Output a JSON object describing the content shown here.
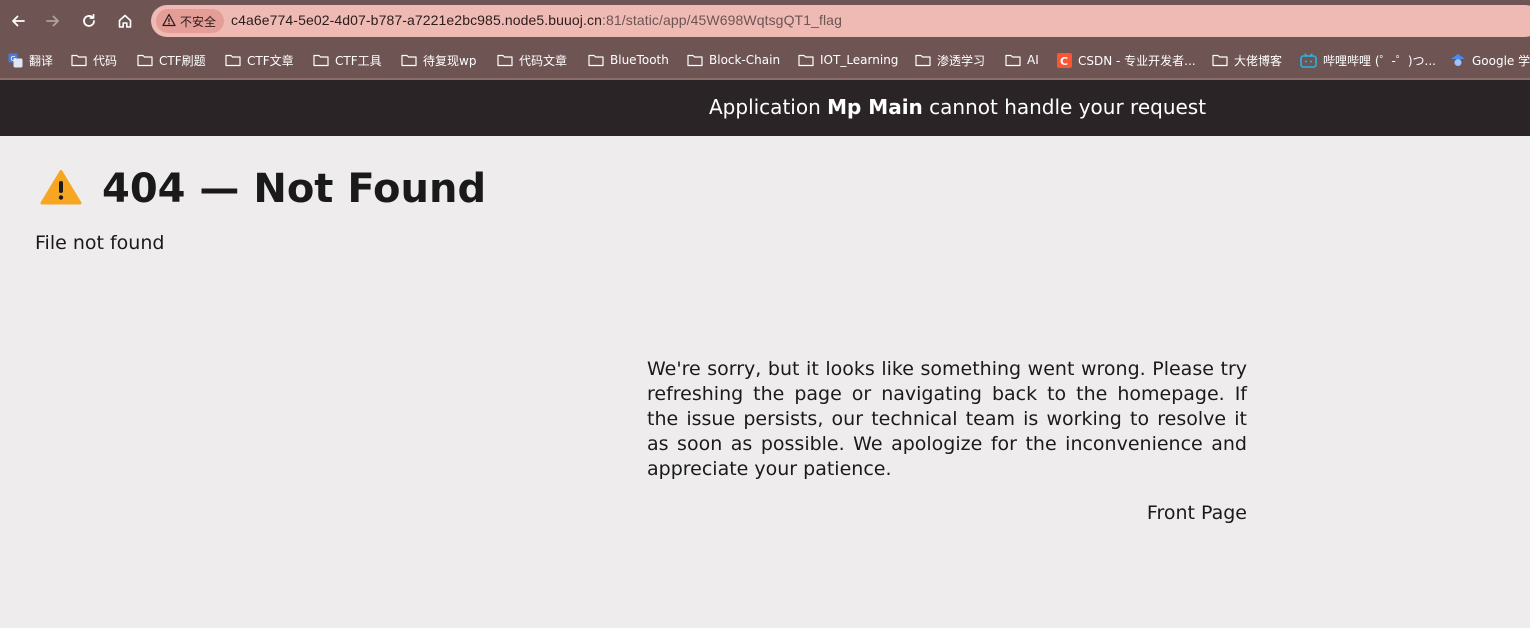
{
  "browser": {
    "security_label": "不安全",
    "url_host": "c4a6e774-5e02-4d07-b787-a7221e2bc985.node5.buuoj.cn",
    "url_path": ":81/static/app/45W698WqtsgQT1_flag",
    "icons": {
      "back": "arrow-left-icon",
      "forward": "arrow-right-icon",
      "reload": "reload-icon",
      "home": "home-icon",
      "security": "warning-triangle-icon"
    },
    "bookmarks": [
      {
        "label": "翻译",
        "icon": "translate-icon"
      },
      {
        "label": "代码",
        "icon": "folder-icon"
      },
      {
        "label": "CTF刷题",
        "icon": "folder-icon"
      },
      {
        "label": "CTF文章",
        "icon": "folder-icon"
      },
      {
        "label": "CTF工具",
        "icon": "folder-icon"
      },
      {
        "label": "待复现wp",
        "icon": "folder-icon"
      },
      {
        "label": "代码文章",
        "icon": "folder-icon"
      },
      {
        "label": "BlueTooth",
        "icon": "folder-icon"
      },
      {
        "label": "Block-Chain",
        "icon": "folder-icon"
      },
      {
        "label": "IOT_Learning",
        "icon": "folder-icon"
      },
      {
        "label": "渗透学习",
        "icon": "folder-icon"
      },
      {
        "label": "AI",
        "icon": "folder-icon"
      },
      {
        "label": "CSDN - 专业开发者...",
        "icon": "csdn-icon"
      },
      {
        "label": "大佬博客",
        "icon": "folder-icon"
      },
      {
        "label": "哔哩哔哩 (゜-゜)つ...",
        "icon": "bilibili-icon"
      },
      {
        "label": "Google 学",
        "icon": "google-scholar-icon"
      }
    ],
    "colors": {
      "chrome_bg": "#6e5554",
      "omnibox_bg": "#efbab3",
      "security_chip_bg": "#e49e97"
    }
  },
  "page": {
    "header_prefix": "Application ",
    "header_app_name": "Mp Main",
    "header_suffix": " cannot handle your request",
    "title": "404 — Not Found",
    "title_icon": "warning-icon",
    "subtitle": "File not found",
    "message": "We're sorry, but it looks like something went wrong. Please try refreshing the page or navigating back to the homepage. If the issue persists, our technical team is working to resolve it as soon as possible. We apologize for the inconvenience and appreciate your patience.",
    "front_page_link": "Front Page",
    "colors": {
      "header_bg": "#2a2426",
      "page_bg": "#eeeced",
      "warning": "#f6a623"
    }
  }
}
